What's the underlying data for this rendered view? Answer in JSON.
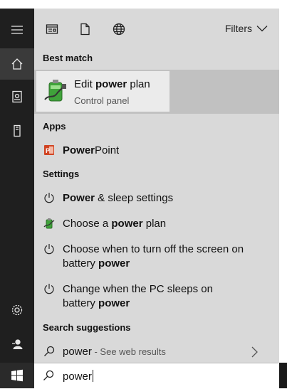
{
  "rail": {
    "icons": [
      "hamburger-icon",
      "home-icon",
      "notebook-icon",
      "tower-icon",
      "gear-icon",
      "feedback-icon",
      "windows-icon"
    ]
  },
  "topbar": {
    "filters_label": "Filters"
  },
  "sections": {
    "best_match": "Best match",
    "apps": "Apps",
    "settings": "Settings",
    "search_suggestions": "Search suggestions"
  },
  "best_match": {
    "title_pre": "Edit ",
    "title_bold": "power",
    "title_post": " plan",
    "subtitle": "Control panel"
  },
  "apps": [
    {
      "bold": "Power",
      "rest": "Point"
    }
  ],
  "settings": [
    {
      "pre": "",
      "bold": "Power",
      "post": " & sleep settings",
      "line2_pre": "",
      "line2_bold": ""
    },
    {
      "pre": "Choose a ",
      "bold": "power",
      "post": " plan",
      "line2_pre": "",
      "line2_bold": ""
    },
    {
      "pre": "Choose when to turn off the screen on",
      "bold": "",
      "post": "",
      "line2_pre": "battery ",
      "line2_bold": "power"
    },
    {
      "pre": "Change when the PC sleeps on",
      "bold": "",
      "post": "",
      "line2_pre": "battery ",
      "line2_bold": "power"
    }
  ],
  "suggestion": {
    "term": "power",
    "more": " - See web results"
  },
  "search": {
    "value": "power"
  }
}
